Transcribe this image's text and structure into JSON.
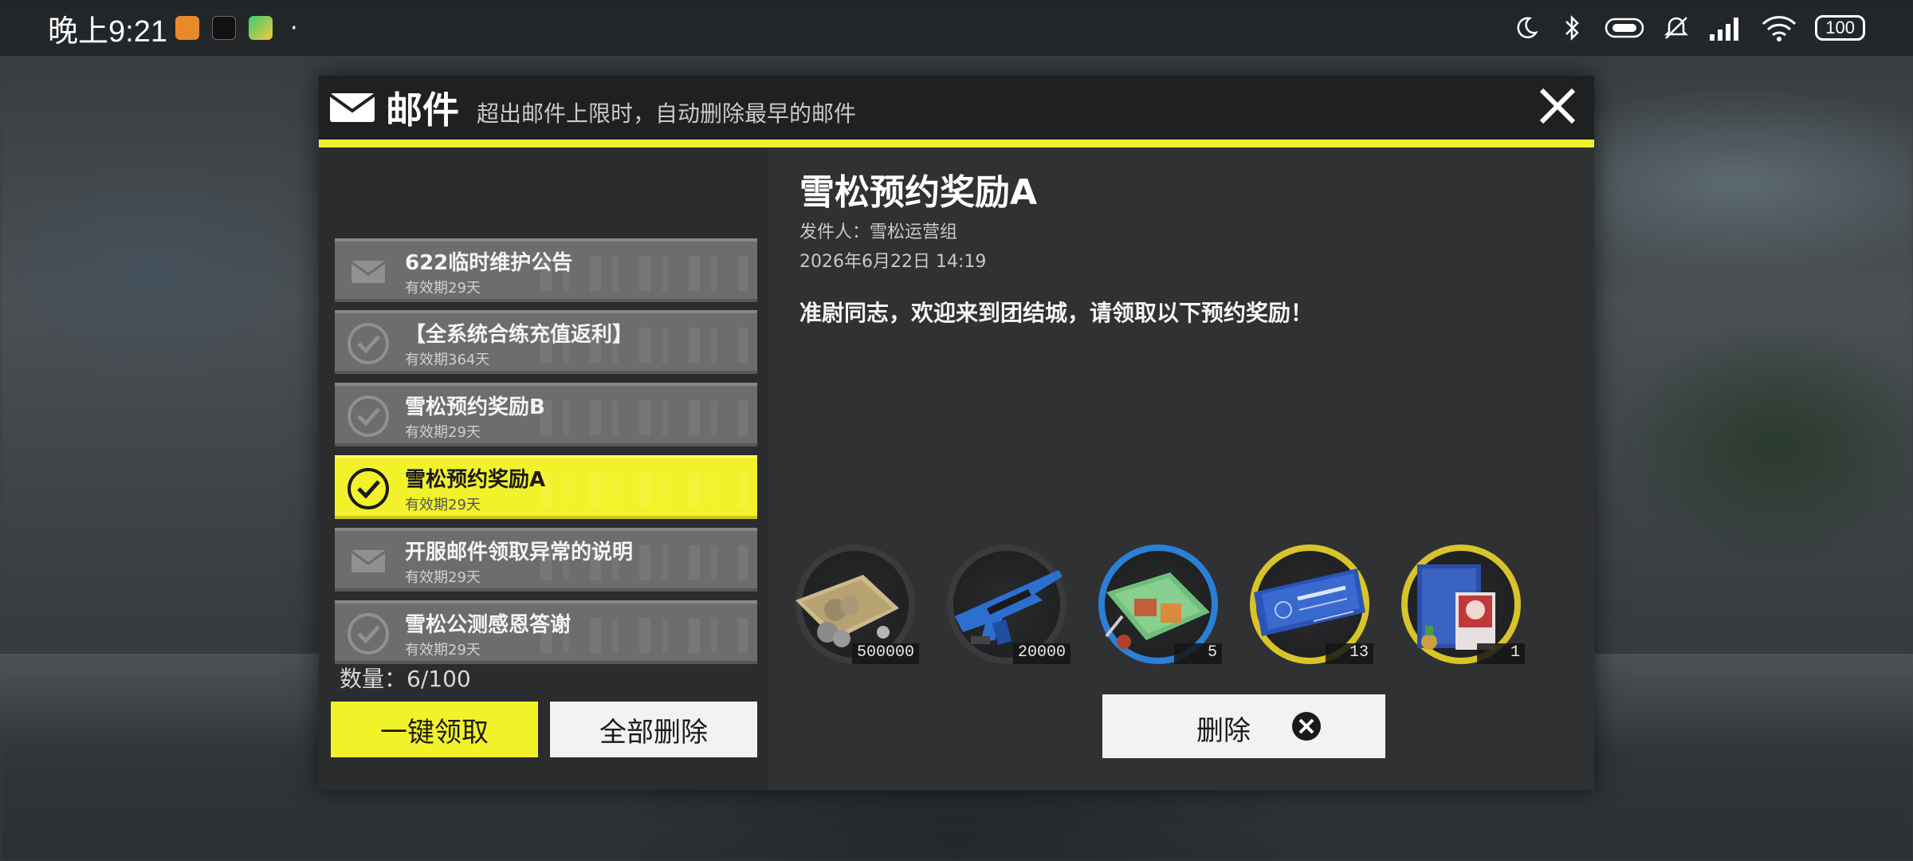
{
  "status_bar": {
    "time": "晚上9:21",
    "battery": "100"
  },
  "header": {
    "title": "邮件",
    "subtitle": "超出邮件上限时，自动删除最早的邮件"
  },
  "mail_list": [
    {
      "name": "622临时维护公告",
      "validity": "有效期29天",
      "icon": "envelope-icon",
      "selected": false
    },
    {
      "name": "【全系统合练充值返利】",
      "validity": "有效期364天",
      "icon": "check-circle-icon",
      "selected": false
    },
    {
      "name": "雪松预约奖励B",
      "validity": "有效期29天",
      "icon": "check-circle-icon",
      "selected": false
    },
    {
      "name": "雪松预约奖励A",
      "validity": "有效期29天",
      "icon": "check-circle-icon",
      "selected": true
    },
    {
      "name": "开服邮件领取异常的说明",
      "validity": "有效期29天",
      "icon": "envelope-icon",
      "selected": false
    },
    {
      "name": "雪松公测感恩答谢",
      "validity": "有效期29天",
      "icon": "check-circle-icon",
      "selected": false
    }
  ],
  "count_label": "数量：6/100",
  "buttons": {
    "claim_all": "一键领取",
    "delete_all": "全部删除",
    "delete": "删除"
  },
  "detail": {
    "title": "雪松预约奖励A",
    "sender": "发件人：雪松运营组",
    "date": "2026年6月22日  14:19",
    "body": "准尉同志，欢迎来到团结城，请领取以下预约奖励！"
  },
  "rewards": [
    {
      "item": "money-bundle",
      "quantity": "500000",
      "ring_color": "#3a3b3d"
    },
    {
      "item": "blue-rifle",
      "quantity": "20000",
      "ring_color": "#3a3b3d"
    },
    {
      "item": "food-ration",
      "quantity": "5",
      "ring_color": "#2b7fd6"
    },
    {
      "item": "airline-ticket",
      "quantity": "13",
      "ring_color": "#d8c42a"
    },
    {
      "item": "dossier-medal",
      "quantity": "1",
      "ring_color": "#d8c42a"
    }
  ],
  "colors": {
    "accent_yellow": "#f2f22a",
    "panel_bg": "#2f3133"
  }
}
